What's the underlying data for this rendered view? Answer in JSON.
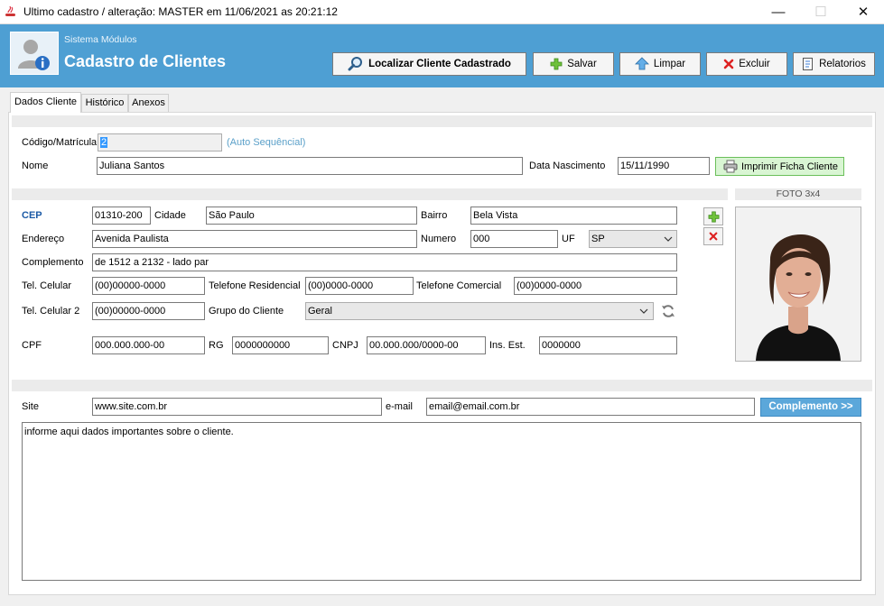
{
  "window": {
    "title": "Ultimo cadastro / alteração:   MASTER em 11/06/2021 as 20:21:12",
    "minimize": "—",
    "maximize": "☐",
    "close": "✕"
  },
  "header": {
    "subtitle": "Sistema Módulos",
    "title": "Cadastro de Clientes",
    "icon": "user-info-icon"
  },
  "toolbar": {
    "find": "Localizar Cliente Cadastrado",
    "save": "Salvar",
    "clear": "Limpar",
    "delete": "Excluir",
    "reports": "Relatorios"
  },
  "tabs": [
    "Dados Cliente",
    "Histórico",
    "Anexos"
  ],
  "form": {
    "codigo_label": "Código/Matrícula",
    "codigo_value": "2",
    "codigo_hint": "(Auto Sequêncial)",
    "nome_label": "Nome",
    "nome_value": "Juliana Santos",
    "nasc_label": "Data Nascimento",
    "nasc_value": "15/11/1990",
    "print_button": "Imprimir Ficha Cliente",
    "cep_label": "CEP",
    "cep_value": "01310-200",
    "cidade_label": "Cidade",
    "cidade_value": "São Paulo",
    "bairro_label": "Bairro",
    "bairro_value": "Bela Vista",
    "endereco_label": "Endereço",
    "endereco_value": "Avenida Paulista",
    "numero_label": "Numero",
    "numero_value": "000",
    "uf_label": "UF",
    "uf_value": "SP",
    "complemento_label": "Complemento",
    "complemento_value": "de 1512 a 2132 - lado par",
    "cel_label": "Tel. Celular",
    "cel_value": "(00)00000-0000",
    "tel_res_label": "Telefone Residencial",
    "tel_res_value": "(00)0000-0000",
    "tel_com_label": "Telefone Comercial",
    "tel_com_value": "(00)0000-0000",
    "cel2_label": "Tel. Celular 2",
    "cel2_value": "(00)00000-0000",
    "grupo_label": "Grupo do Cliente",
    "grupo_value": "Geral",
    "cpf_label": "CPF",
    "cpf_value": "000.000.000-00",
    "rg_label": "RG",
    "rg_value": "0000000000",
    "cnpj_label": "CNPJ",
    "cnpj_value": "00.000.000/0000-00",
    "ie_label": "Ins. Est.",
    "ie_value": "0000000",
    "foto_label": "FOTO 3x4",
    "site_label": "Site",
    "site_value": "www.site.com.br",
    "email_label": "e-mail",
    "email_value": "email@email.com.br",
    "complemento_button": "Complemento >>",
    "notes_value": "informe aqui dados importantes sobre o cliente."
  },
  "colors": {
    "banner": "#4e9fd3",
    "accent_blue": "#1b5aa6",
    "hint": "#5ba0c9",
    "complement_button": "#5ba7da",
    "print_button_bg": "#d9f5d3"
  }
}
